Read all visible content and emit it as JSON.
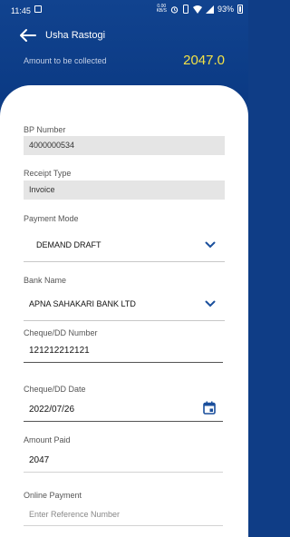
{
  "statusbar": {
    "time": "11:45",
    "network_top": "0.00",
    "network_bottom": "KB/S",
    "battery": "93%"
  },
  "header": {
    "title": "Usha Rastogi",
    "amount_label": "Amount to be collected",
    "amount_value": "2047.0",
    "amount_color": "#f3e246",
    "background": "#0f3d86"
  },
  "form": {
    "bp_number": {
      "label": "BP Number",
      "value": "4000000534"
    },
    "receipt_type": {
      "label": "Receipt Type",
      "value": "Invoice"
    },
    "payment_mode": {
      "label": "Payment Mode",
      "value": "DEMAND DRAFT"
    },
    "bank_name": {
      "label": "Bank Name",
      "value": "APNA SAHAKARI BANK LTD"
    },
    "cheque_number": {
      "label": "Cheque/DD Number",
      "value": "121212212121"
    },
    "cheque_date": {
      "label": "Cheque/DD Date",
      "value": "2022/07/26"
    },
    "amount_paid": {
      "label": "Amount Paid",
      "value": "2047"
    },
    "online_payment": {
      "label": "Online Payment",
      "placeholder": "Enter Reference Number"
    }
  },
  "icons": {
    "back": "arrow-left-icon",
    "caret": "chevron-down-icon",
    "calendar": "calendar-icon",
    "accent": "#1a4f9c"
  }
}
